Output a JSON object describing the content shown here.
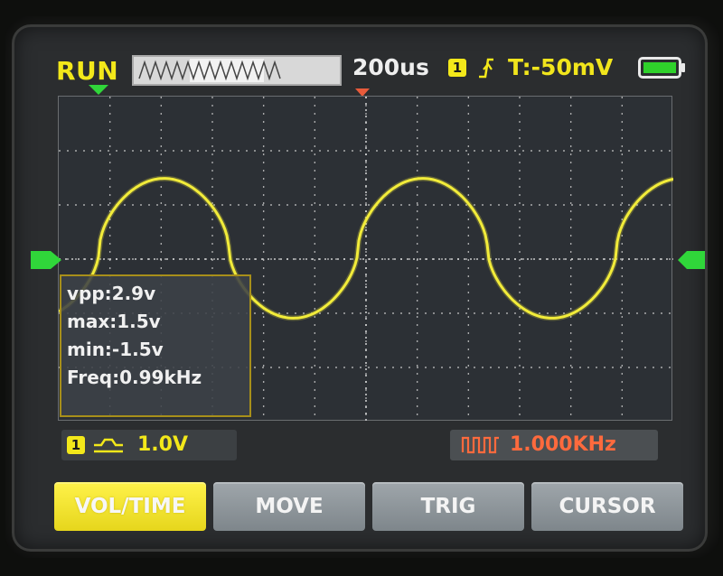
{
  "top_bar": {
    "run_state": "RUN",
    "timebase": "200us",
    "channel_badge": "1",
    "trigger_level": "T:-50mV",
    "trigger_edge_icon": "rising-edge-icon",
    "battery_level_fraction": 1.0
  },
  "measurements": {
    "vpp": "vpp:2.9v",
    "max": "max:1.5v",
    "min": "min:-1.5v",
    "freq": "Freq:0.99kHz"
  },
  "channel_scale": {
    "badge": "1",
    "coupling_icon": "dc-coupling-icon",
    "value": "1.0V"
  },
  "generator": {
    "icon": "square-wave-icon",
    "value": "1.000KHz"
  },
  "softkeys": [
    {
      "label": "VOL/TIME",
      "active": true
    },
    {
      "label": "MOVE",
      "active": false
    },
    {
      "label": "TRIG",
      "active": false
    },
    {
      "label": "CURSOR",
      "active": false
    }
  ],
  "colors": {
    "trace": "#f2ec3a",
    "accent": "#f3e81a",
    "generator": "#ff6a3d",
    "marker_green": "#30d63a",
    "marker_red": "#e85b3b"
  }
}
